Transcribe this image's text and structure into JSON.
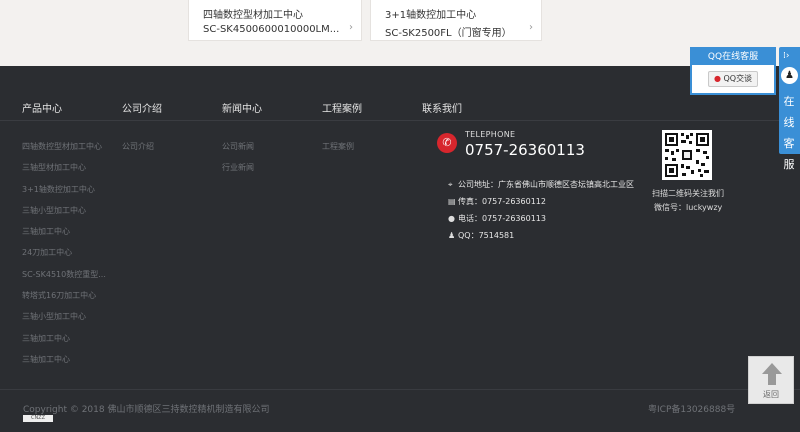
{
  "products_top": [
    {
      "title": "四轴数控型材加工中心",
      "model": "SC-SK4500600010000LM...",
      "arrow": "›"
    },
    {
      "title": "3+1轴数控加工中心",
      "model": "SC-SK2500FL（门窗专用）",
      "arrow": "›"
    }
  ],
  "footer": {
    "columns": [
      {
        "heading": "产品中心",
        "links": [
          "四轴数控型材加工中心",
          "三轴型材加工中心",
          "3+1轴数控加工中心",
          "三轴小型加工中心",
          "三轴加工中心",
          "24刀加工中心",
          "SC-SK4510数控重型...",
          "转塔式16刀加工中心",
          "三轴小型加工中心",
          "三轴加工中心",
          "三轴加工中心"
        ]
      },
      {
        "heading": "公司介绍",
        "links": [
          "公司介绍"
        ]
      },
      {
        "heading": "新闻中心",
        "links": [
          "公司新闻",
          "行业新闻"
        ]
      },
      {
        "heading": "工程案例",
        "links": [
          "工程案例"
        ]
      },
      {
        "heading": "联系我们",
        "links": []
      }
    ],
    "contact": {
      "tel_label": "TELEPHONE",
      "tel_number": "0757-26360113",
      "address": "公司地址：广东省佛山市顺德区杏坛镇高北工业区",
      "fax": "传真：0757-26360112",
      "phone": "电话：0757-26360113",
      "qq": "QQ：7514581"
    },
    "qr": {
      "caption1": "扫描二维码关注我们",
      "caption2": "微信号：luckywzy"
    },
    "copyright": "Copyright © 2018 佛山市顺德区三持数控精机制造有限公司",
    "icp": "粤ICP备13026888号",
    "cnzz": "CNZZ"
  },
  "qq_widget": {
    "title": "QQ在线客服",
    "button": "QQ交谈",
    "tab_text": "在线客服"
  },
  "back_top": {
    "label": "返回"
  },
  "colors": {
    "footer_bg": "#2b2d31",
    "accent_blue": "#3a8fd6",
    "phone_red": "#d7262d"
  }
}
